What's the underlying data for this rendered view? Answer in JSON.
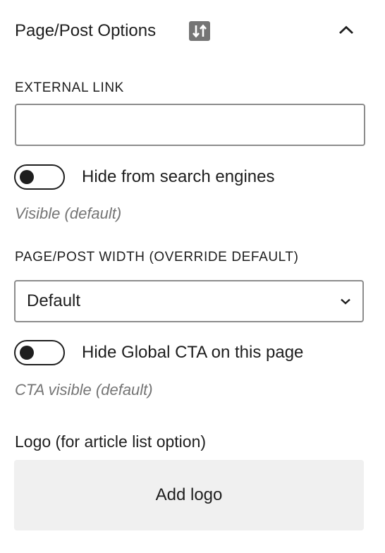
{
  "panel": {
    "title": "Page/Post Options",
    "plugin_icon": "sliders-sort-icon",
    "collapse_icon": "chevron-up-icon"
  },
  "external_link": {
    "label": "EXTERNAL LINK",
    "value": "",
    "placeholder": ""
  },
  "search_toggle": {
    "label": "Hide from search engines",
    "checked": false,
    "help": "Visible (default)"
  },
  "width_select": {
    "label": "PAGE/POST WIDTH (OVERRIDE DEFAULT)",
    "selected": "Default",
    "chevron_icon": "chevron-down-icon"
  },
  "cta_toggle": {
    "label": "Hide Global CTA on this page",
    "checked": false,
    "help": "CTA visible (default)"
  },
  "logo": {
    "label": "Logo (for article list option)",
    "button_label": "Add logo"
  },
  "colors": {
    "text": "#1e1e1e",
    "help_text": "#757575",
    "border": "#8c8c8c",
    "button_bg": "#f0f0f0",
    "icon_bg": "#757575"
  }
}
